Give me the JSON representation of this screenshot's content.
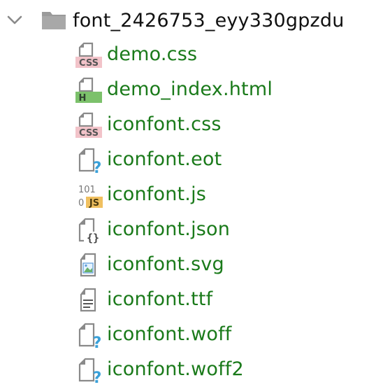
{
  "colors": {
    "file_text": "#1a7a1a",
    "folder_text": "#111111",
    "icon_grey": "#7d7d7d",
    "css_badge_bg": "#f2c3c9",
    "css_badge_text": "#5a5a5a",
    "html_badge_bg": "#7cc16b",
    "js_badge_bg": "#f0c060",
    "question_blue": "#3aa0d8"
  },
  "folder": {
    "icon": "folder-icon",
    "toggle_icon": "chevron-down-icon",
    "name": "font_2426753_eyy330gpzdu"
  },
  "files": [
    {
      "name": "demo.css",
      "icon": "css-file-icon",
      "badge": "CSS"
    },
    {
      "name": "demo_index.html",
      "icon": "html-file-icon",
      "badge": "H"
    },
    {
      "name": "iconfont.css",
      "icon": "css-file-icon",
      "badge": "CSS"
    },
    {
      "name": "iconfont.eot",
      "icon": "unknown-file-icon",
      "badge": "?"
    },
    {
      "name": "iconfont.js",
      "icon": "js-file-icon",
      "badge": "JS",
      "top_text": "101",
      "side_text": "0"
    },
    {
      "name": "iconfont.json",
      "icon": "json-file-icon",
      "badge": "{}"
    },
    {
      "name": "iconfont.svg",
      "icon": "image-file-icon"
    },
    {
      "name": "iconfont.ttf",
      "icon": "text-file-icon"
    },
    {
      "name": "iconfont.woff",
      "icon": "unknown-file-icon",
      "badge": "?"
    },
    {
      "name": "iconfont.woff2",
      "icon": "unknown-file-icon",
      "badge": "?"
    }
  ]
}
